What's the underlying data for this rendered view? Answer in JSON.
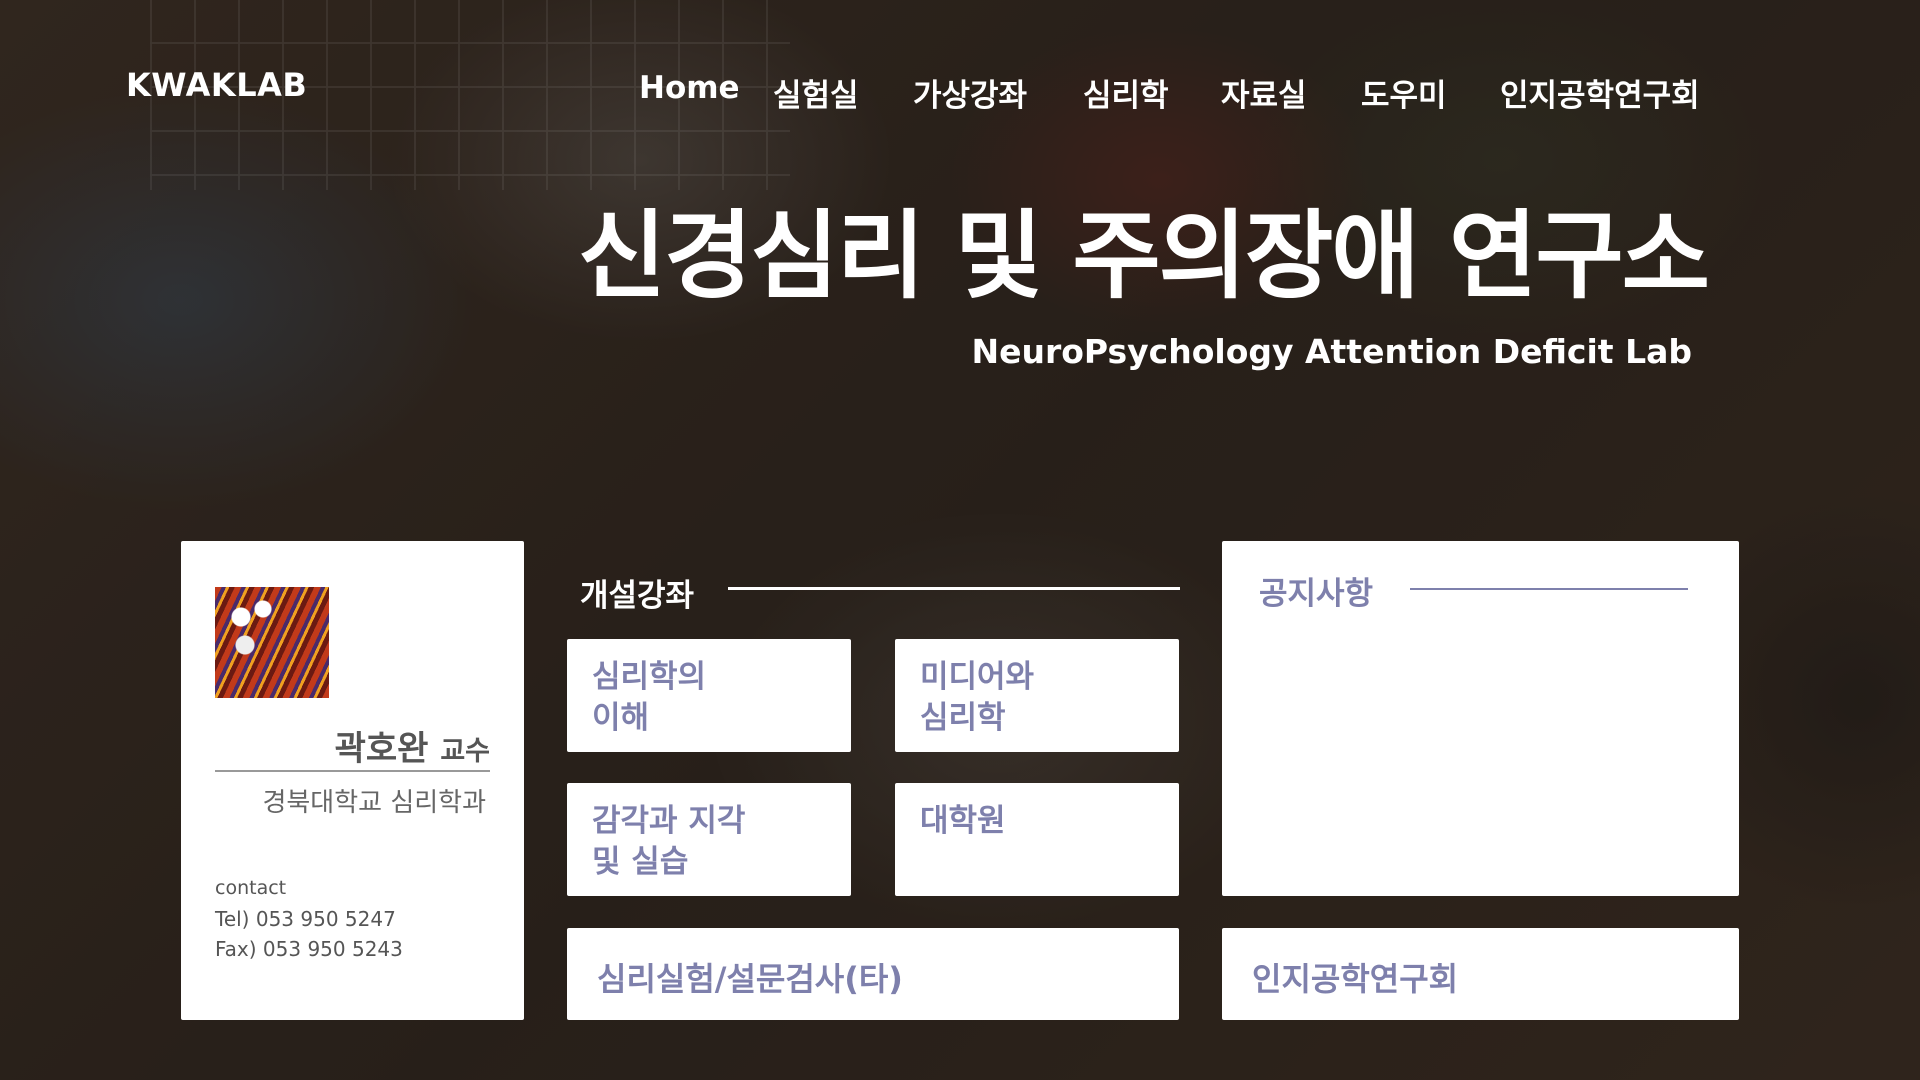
{
  "header": {
    "logo": "KWAKLAB",
    "nav": [
      "Home",
      "실험실",
      "가상강좌",
      "심리학",
      "자료실",
      "도우미",
      "인지공학연구회"
    ]
  },
  "hero": {
    "title": "신경심리 및 주의장애 연구소",
    "subtitle": "NeuroPsychology Attention Deficit Lab"
  },
  "profile": {
    "name": "곽호완",
    "title": "교수",
    "department": "경북대학교 심리학과",
    "contact_label": "contact",
    "tel": "Tel) 053 950 5247",
    "fax": "Fax) 053 950 5243"
  },
  "courses": {
    "heading": "개설강좌",
    "items": [
      "심리학의\n이해",
      "미디어와\n심리학",
      "감각과 지각\n및 실습",
      "대학원"
    ]
  },
  "notice": {
    "heading": "공지사항"
  },
  "links": {
    "experiment": "심리실험/설문검사(타)",
    "society": "인지공학연구회"
  },
  "colors": {
    "accent": "#7e80ac",
    "card_bg": "#ffffff",
    "header_text": "#ffffff"
  }
}
